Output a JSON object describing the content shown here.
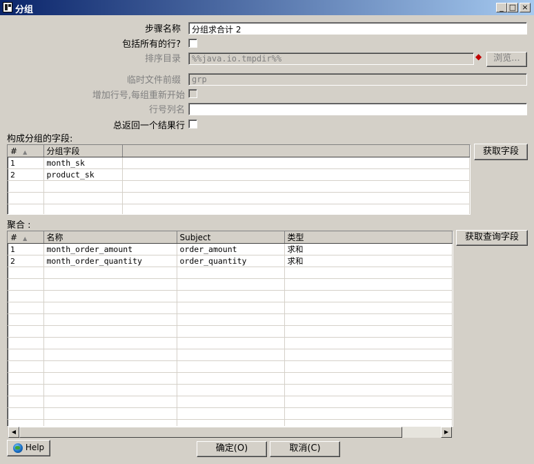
{
  "window": {
    "title": "分组",
    "min_glyph": "_",
    "max_glyph": "□",
    "close_glyph": "×"
  },
  "form": {
    "step_name_label": "步骤名称",
    "step_name_value": "分组求合计 2",
    "include_all_rows_label": "包括所有的行?",
    "sort_dir_label": "排序目录",
    "sort_dir_value": "%%java.io.tmpdir%%",
    "browse_label": "浏览...",
    "temp_prefix_label": "临时文件前缀",
    "temp_prefix_value": "grp",
    "add_line_number_label": "增加行号,每组重新开始",
    "line_number_field_label": "行号列名",
    "line_number_field_value": "",
    "always_one_row_label": "总返回一个结果行"
  },
  "group_section": {
    "label": "构成分组的字段:",
    "get_fields_label": "获取字段",
    "columns": [
      "#",
      "分组字段"
    ],
    "rows": [
      {
        "num": "1",
        "field": "month_sk"
      },
      {
        "num": "2",
        "field": "product_sk"
      }
    ]
  },
  "agg_section": {
    "label": "聚合 :",
    "get_lookup_fields_label": "获取查询字段",
    "columns": [
      "#",
      "名称",
      "Subject",
      "类型"
    ],
    "rows": [
      {
        "num": "1",
        "name": "month_order_amount",
        "subject": "order_amount",
        "type": "求和"
      },
      {
        "num": "2",
        "name": "month_order_quantity",
        "subject": "order_quantity",
        "type": "求和"
      }
    ]
  },
  "footer": {
    "help_label": "Help",
    "ok_label": "确定(O)",
    "cancel_label": "取消(C)"
  },
  "icons": {
    "warning": "warning-diamond-icon",
    "sort": "sort-ascending-icon",
    "help": "help-globe-icon"
  }
}
